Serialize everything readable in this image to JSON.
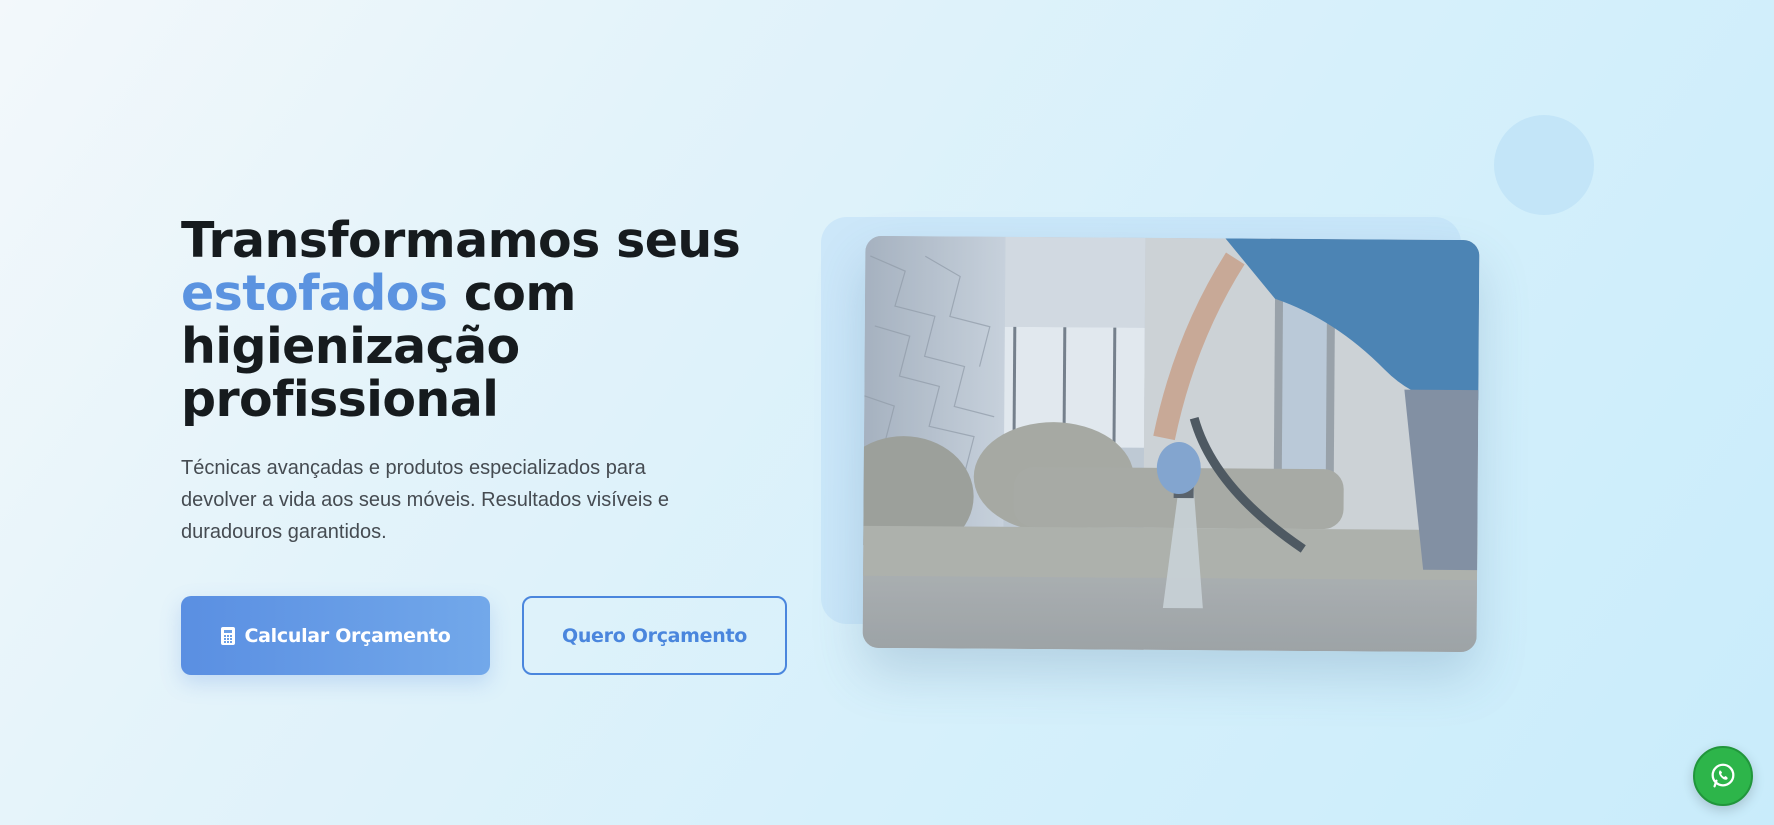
{
  "hero": {
    "headline": {
      "part1": "Transformamos seus",
      "accent": "estofados",
      "part2": "com higienização profissional"
    },
    "subtitle": "Técnicas avançadas e produtos especializados para devolver a vida aos seus móveis. Resultados visíveis e duradouros garantidos.",
    "primary_button": {
      "label": "Calcular Orçamento",
      "icon": "calculator-icon"
    },
    "secondary_button": {
      "label": "Quero Orçamento"
    },
    "image": {
      "subject": "technician-cleaning-sofa"
    }
  },
  "floating": {
    "whatsapp_icon": "whatsapp-icon"
  },
  "colors": {
    "accent": "#5b93e0",
    "primary_button": "#5a8fe2",
    "secondary_border": "#4a86dd",
    "whatsapp": "#2db54a",
    "headline": "#161b1e"
  }
}
